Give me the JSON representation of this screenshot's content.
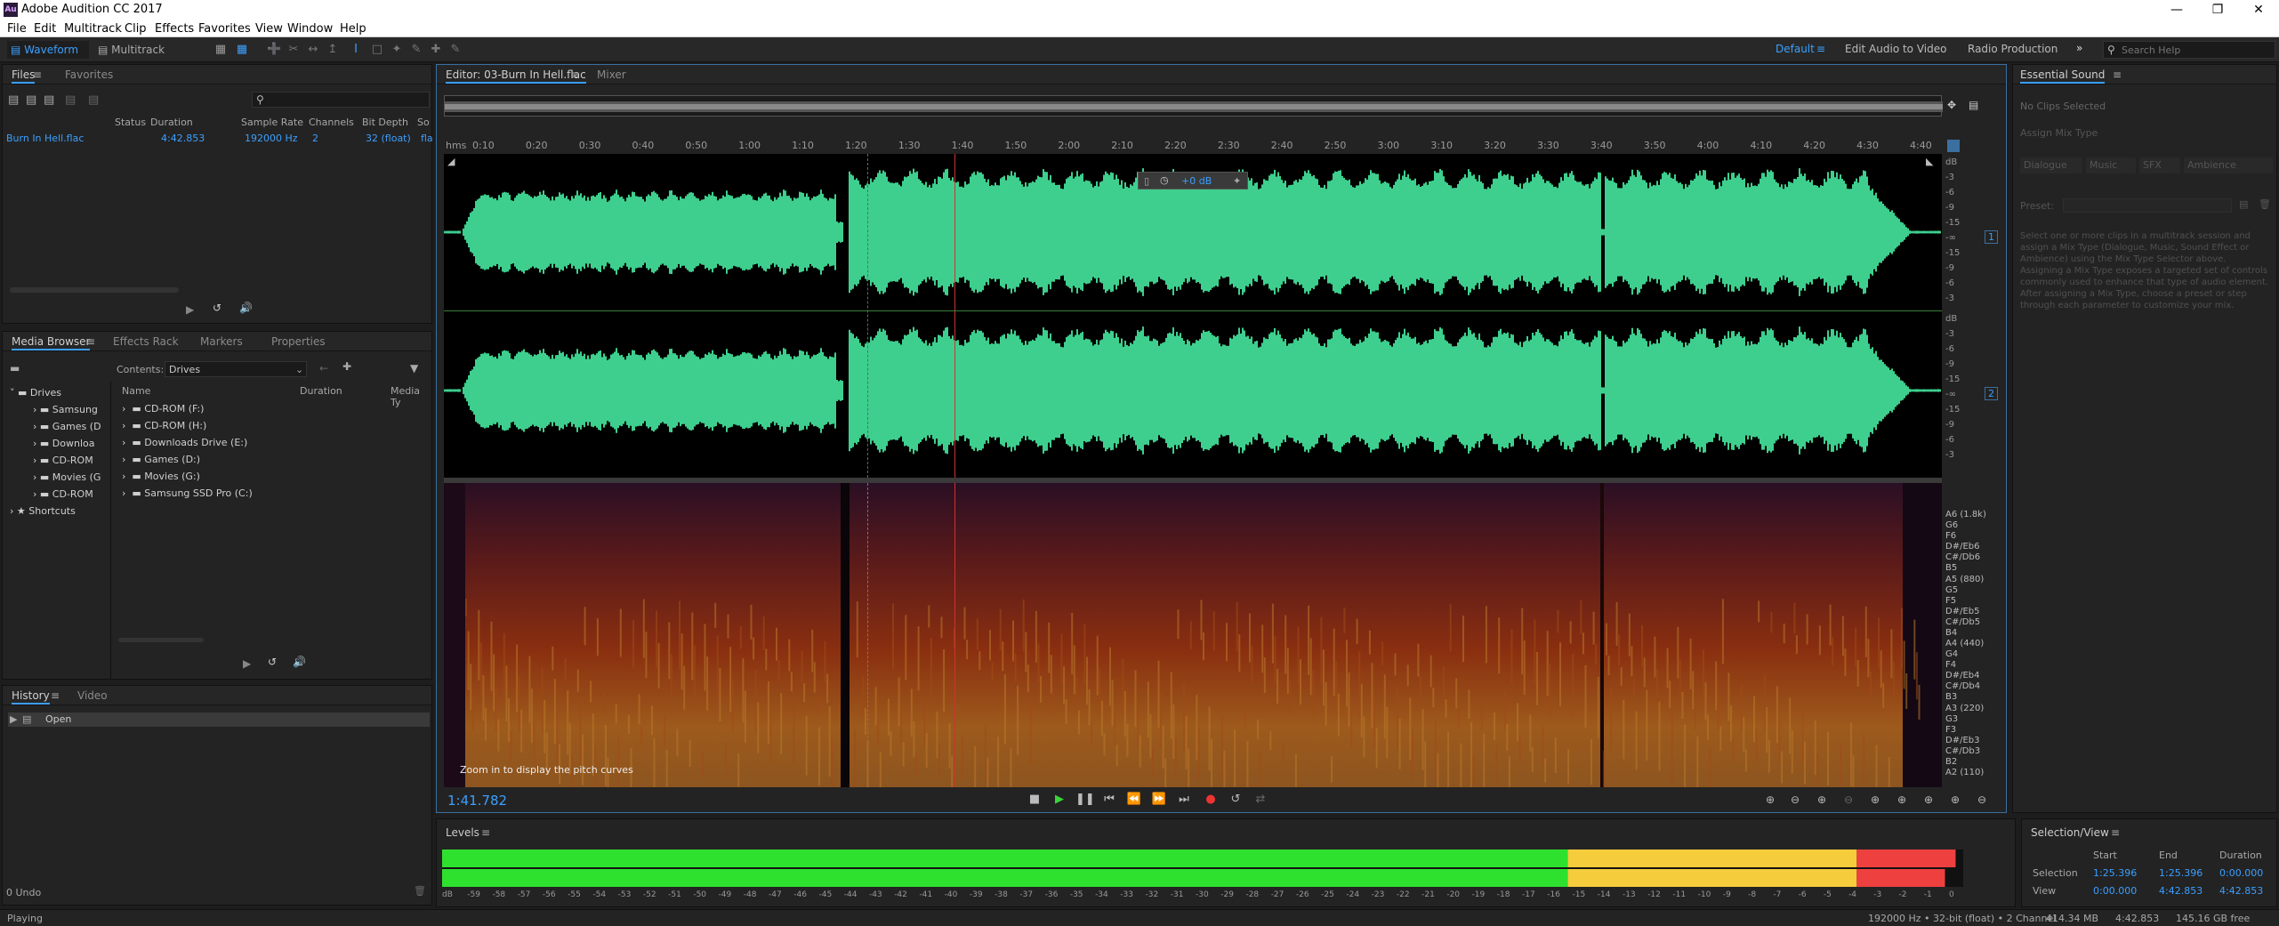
{
  "window": {
    "title": "Adobe Audition CC 2017",
    "app_icon_label": "Au"
  },
  "menu": [
    "File",
    "Edit",
    "Multitrack",
    "Clip",
    "Effects",
    "Favorites",
    "View",
    "Window",
    "Help"
  ],
  "toolbar": {
    "waveform": "Waveform",
    "multitrack": "Multitrack"
  },
  "workspaces": {
    "default": "Default",
    "edit_audio_video": "Edit Audio to Video",
    "radio": "Radio Production",
    "more": "»"
  },
  "search": {
    "placeholder": "Search Help"
  },
  "files_panel": {
    "tabs": [
      "Files",
      "Favorites"
    ],
    "columns": [
      "Status",
      "Duration",
      "Sample Rate",
      "Channels",
      "Bit Depth",
      "So"
    ],
    "rows": [
      {
        "name": "Burn In Hell.flac",
        "duration": "4:42.853",
        "sample_rate": "192000 Hz",
        "channels": "2",
        "bit_depth": "32 (float)",
        "source": "fla"
      }
    ]
  },
  "media_browser": {
    "tabs": [
      "Media Browser",
      "Effects Rack",
      "Markers",
      "Properties"
    ],
    "contents_label": "Contents:",
    "contents_value": "Drives",
    "left_tree": [
      "Drives",
      "Samsung",
      "Games (D",
      "Downloa",
      "CD-ROM",
      "Movies (G",
      "CD-ROM",
      "Shortcuts"
    ],
    "columns": [
      "Name",
      "Duration",
      "Media Ty"
    ],
    "items": [
      "CD-ROM (F:)",
      "CD-ROM (H:)",
      "Downloads Drive (E:)",
      "Games (D:)",
      "Movies (G:)",
      "Samsung SSD Pro (C:)"
    ]
  },
  "history": {
    "tabs": [
      "History",
      "Video"
    ],
    "items": [
      "Open"
    ],
    "undo": "0 Undo"
  },
  "editor": {
    "tabs": [
      "Editor: 03-Burn In Hell.flac",
      "Mixer"
    ],
    "ruler_unit": "hms",
    "ruler": [
      "0:10",
      "0:20",
      "0:30",
      "0:40",
      "0:50",
      "1:00",
      "1:10",
      "1:20",
      "1:30",
      "1:40",
      "1:50",
      "2:00",
      "2:10",
      "2:20",
      "2:30",
      "2:40",
      "2:50",
      "3:00",
      "3:10",
      "3:20",
      "3:30",
      "3:40",
      "3:50",
      "4:00",
      "4:10",
      "4:20",
      "4:30",
      "4:40"
    ],
    "db_scale": [
      "dB",
      "-3",
      "-6",
      "-9",
      "-15",
      "-∞",
      "-15",
      "-9",
      "-6",
      "-3"
    ],
    "channel_labels": [
      "1",
      "2"
    ],
    "hud_gain": "+0 dB",
    "pitch_labels": [
      "A6 (1.8k)",
      "G6",
      "F6",
      "D#/Eb6",
      "C#/Db6",
      "B5",
      "A5 (880)",
      "G5",
      "F5",
      "D#/Eb5",
      "C#/Db5",
      "B4",
      "A4 (440)",
      "G4",
      "F4",
      "D#/Eb4",
      "C#/Db4",
      "B3",
      "A3 (220)",
      "G3",
      "F3",
      "D#/Eb3",
      "C#/Db3",
      "B2",
      "A2 (110)"
    ],
    "pitch_note": "Zoom in to display the pitch curves",
    "current_time": "1:41.782"
  },
  "essential_sound": {
    "title": "Essential Sound",
    "no_clips": "No Clips Selected",
    "assign": "Assign Mix Type",
    "types": [
      "Dialogue",
      "Music",
      "SFX",
      "Ambience"
    ],
    "preset_label": "Preset:",
    "description": "Select one or more clips in a multitrack session and assign a Mix Type (Dialogue, Music, Sound Effect or Ambience) using the Mix Type Selector above. Assigning a Mix Type exposes a targeted set of controls commonly used to enhance that type of audio element. After assigning a Mix Type, choose a preset or step through each parameter to customize your mix."
  },
  "levels": {
    "title": "Levels",
    "scale": [
      "dB",
      "-59",
      "-58",
      "-57",
      "-56",
      "-55",
      "-54",
      "-53",
      "-52",
      "-51",
      "-50",
      "-49",
      "-48",
      "-47",
      "-46",
      "-45",
      "-44",
      "-43",
      "-42",
      "-41",
      "-40",
      "-39",
      "-38",
      "-37",
      "-36",
      "-35",
      "-34",
      "-33",
      "-32",
      "-31",
      "-30",
      "-29",
      "-28",
      "-27",
      "-26",
      "-25",
      "-24",
      "-23",
      "-22",
      "-21",
      "-20",
      "-19",
      "-18",
      "-17",
      "-16",
      "-15",
      "-14",
      "-13",
      "-12",
      "-11",
      "-10",
      "-9",
      "-8",
      "-7",
      "-6",
      "-5",
      "-4",
      "-3",
      "-2",
      "-1",
      "0"
    ],
    "fill_left": 0.995,
    "fill_right": 0.988,
    "colors": {
      "green": "#2fe12f",
      "yellow": "#f5cc3c",
      "red": "#ef4040"
    }
  },
  "selection_view": {
    "title": "Selection/View",
    "headers": [
      "Start",
      "End",
      "Duration"
    ],
    "selection": [
      "Selection",
      "1:25.396",
      "1:25.396",
      "0:00.000"
    ],
    "view": [
      "View",
      "0:00.000",
      "4:42.853",
      "4:42.853"
    ]
  },
  "status": {
    "left": "Playing",
    "format": "192000 Hz • 32-bit (float) • 2 Channel",
    "size": "414.34 MB",
    "duration": "4:42.853",
    "free": "145.16 GB free"
  }
}
